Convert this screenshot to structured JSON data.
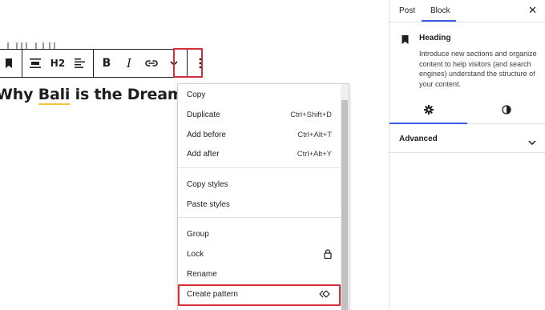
{
  "toolbar": {
    "heading_level": "H2",
    "bold": "B",
    "italic": "I"
  },
  "editor": {
    "heading_prefix": "Why ",
    "heading_word_underlined": "Bali",
    "heading_suffix": " is the Dream Des"
  },
  "menu": {
    "group1": [
      {
        "label": "Copy",
        "shortcut": ""
      },
      {
        "label": "Duplicate",
        "shortcut": "Ctrl+Shift+D"
      },
      {
        "label": "Add before",
        "shortcut": "Ctrl+Alt+T"
      },
      {
        "label": "Add after",
        "shortcut": "Ctrl+Alt+Y"
      }
    ],
    "group2": [
      {
        "label": "Copy styles"
      },
      {
        "label": "Paste styles"
      }
    ],
    "group3": [
      {
        "label": "Group"
      },
      {
        "label": "Lock",
        "icon": "lock-icon"
      },
      {
        "label": "Rename"
      },
      {
        "label": "Create pattern",
        "icon": "symbol-icon"
      }
    ]
  },
  "sidebar": {
    "tabs": [
      "Post",
      "Block"
    ],
    "active_tab": "Block",
    "block": {
      "title": "Heading",
      "description": "Introduce new sections and organize content to help visitors (and search engines) understand the structure of your content."
    },
    "subtabs": [
      "settings",
      "styles"
    ],
    "advanced_label": "Advanced"
  },
  "colors": {
    "highlight": "#d62d3a",
    "accent": "#3858e9",
    "underline": "#f0c33c"
  }
}
